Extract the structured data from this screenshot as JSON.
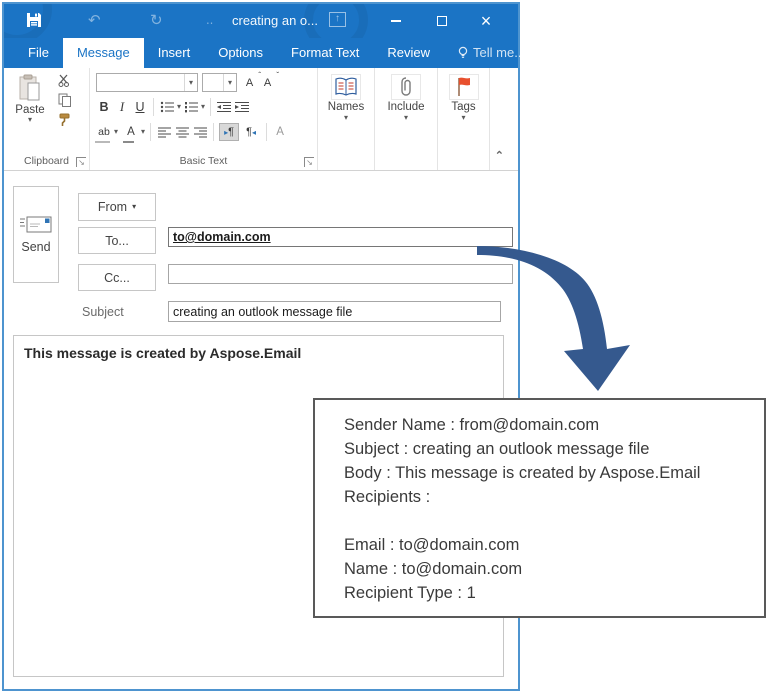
{
  "window": {
    "title": "creating an o..."
  },
  "tabs": [
    {
      "label": "File",
      "active": false
    },
    {
      "label": "Message",
      "active": true
    },
    {
      "label": "Insert",
      "active": false
    },
    {
      "label": "Options",
      "active": false
    },
    {
      "label": "Format Text",
      "active": false
    },
    {
      "label": "Review",
      "active": false
    },
    {
      "label": "Tell me...",
      "active": false
    }
  ],
  "ribbon": {
    "clipboard": {
      "paste_label": "Paste",
      "group_label": "Clipboard"
    },
    "basic_text": {
      "group_label": "Basic Text",
      "bold": "B",
      "italic": "I",
      "underline": "U",
      "grow_font": "A",
      "shrink_font": "A",
      "highlight": "ab",
      "font_color": "A",
      "ltr": "¶",
      "rtl": "¶",
      "clear_format": "A"
    },
    "names": {
      "label": "Names"
    },
    "include": {
      "label": "Include"
    },
    "tags": {
      "label": "Tags"
    }
  },
  "compose": {
    "send_label": "Send",
    "from_label": "From",
    "to_label": "To...",
    "cc_label": "Cc...",
    "subject_label": "Subject",
    "to_value": "to@domain.com",
    "cc_value": "",
    "subject_value": "creating an outlook message file",
    "body_text": "This message is created by Aspose.Email"
  },
  "callout": {
    "lines": [
      "Sender Name : from@domain.com",
      "Subject : creating an outlook message file",
      "Body : This message is created by Aspose.Email",
      "Recipients :",
      "",
      "Email : to@domain.com",
      "Name : to@domain.com",
      "Recipient Type : 1"
    ]
  },
  "icons": {
    "quick_access": [
      "save",
      "undo",
      "redo"
    ],
    "groups": [
      "clipboard",
      "address-book",
      "paperclip",
      "flag"
    ]
  },
  "colors": {
    "titlebar_blue": "#1b74c5",
    "window_border_blue": "#4e94cf",
    "active_tab_text": "#1b74c5",
    "arrow_blue": "#35598e",
    "flag_red": "#e8502e",
    "callout_border": "#595959"
  }
}
